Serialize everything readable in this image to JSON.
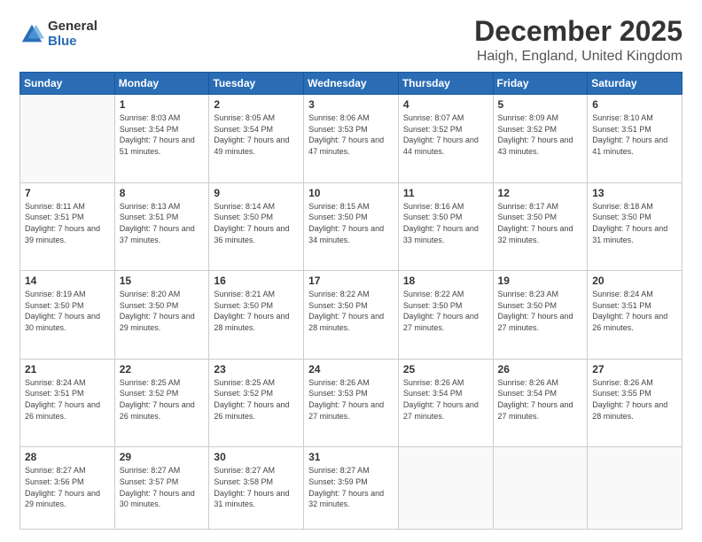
{
  "logo": {
    "general": "General",
    "blue": "Blue"
  },
  "title": "December 2025",
  "subtitle": "Haigh, England, United Kingdom",
  "days": [
    "Sunday",
    "Monday",
    "Tuesday",
    "Wednesday",
    "Thursday",
    "Friday",
    "Saturday"
  ],
  "weeks": [
    [
      {
        "num": "",
        "sunrise": "",
        "sunset": "",
        "daylight": ""
      },
      {
        "num": "1",
        "sunrise": "Sunrise: 8:03 AM",
        "sunset": "Sunset: 3:54 PM",
        "daylight": "Daylight: 7 hours and 51 minutes."
      },
      {
        "num": "2",
        "sunrise": "Sunrise: 8:05 AM",
        "sunset": "Sunset: 3:54 PM",
        "daylight": "Daylight: 7 hours and 49 minutes."
      },
      {
        "num": "3",
        "sunrise": "Sunrise: 8:06 AM",
        "sunset": "Sunset: 3:53 PM",
        "daylight": "Daylight: 7 hours and 47 minutes."
      },
      {
        "num": "4",
        "sunrise": "Sunrise: 8:07 AM",
        "sunset": "Sunset: 3:52 PM",
        "daylight": "Daylight: 7 hours and 44 minutes."
      },
      {
        "num": "5",
        "sunrise": "Sunrise: 8:09 AM",
        "sunset": "Sunset: 3:52 PM",
        "daylight": "Daylight: 7 hours and 43 minutes."
      },
      {
        "num": "6",
        "sunrise": "Sunrise: 8:10 AM",
        "sunset": "Sunset: 3:51 PM",
        "daylight": "Daylight: 7 hours and 41 minutes."
      }
    ],
    [
      {
        "num": "7",
        "sunrise": "Sunrise: 8:11 AM",
        "sunset": "Sunset: 3:51 PM",
        "daylight": "Daylight: 7 hours and 39 minutes."
      },
      {
        "num": "8",
        "sunrise": "Sunrise: 8:13 AM",
        "sunset": "Sunset: 3:51 PM",
        "daylight": "Daylight: 7 hours and 37 minutes."
      },
      {
        "num": "9",
        "sunrise": "Sunrise: 8:14 AM",
        "sunset": "Sunset: 3:50 PM",
        "daylight": "Daylight: 7 hours and 36 minutes."
      },
      {
        "num": "10",
        "sunrise": "Sunrise: 8:15 AM",
        "sunset": "Sunset: 3:50 PM",
        "daylight": "Daylight: 7 hours and 34 minutes."
      },
      {
        "num": "11",
        "sunrise": "Sunrise: 8:16 AM",
        "sunset": "Sunset: 3:50 PM",
        "daylight": "Daylight: 7 hours and 33 minutes."
      },
      {
        "num": "12",
        "sunrise": "Sunrise: 8:17 AM",
        "sunset": "Sunset: 3:50 PM",
        "daylight": "Daylight: 7 hours and 32 minutes."
      },
      {
        "num": "13",
        "sunrise": "Sunrise: 8:18 AM",
        "sunset": "Sunset: 3:50 PM",
        "daylight": "Daylight: 7 hours and 31 minutes."
      }
    ],
    [
      {
        "num": "14",
        "sunrise": "Sunrise: 8:19 AM",
        "sunset": "Sunset: 3:50 PM",
        "daylight": "Daylight: 7 hours and 30 minutes."
      },
      {
        "num": "15",
        "sunrise": "Sunrise: 8:20 AM",
        "sunset": "Sunset: 3:50 PM",
        "daylight": "Daylight: 7 hours and 29 minutes."
      },
      {
        "num": "16",
        "sunrise": "Sunrise: 8:21 AM",
        "sunset": "Sunset: 3:50 PM",
        "daylight": "Daylight: 7 hours and 28 minutes."
      },
      {
        "num": "17",
        "sunrise": "Sunrise: 8:22 AM",
        "sunset": "Sunset: 3:50 PM",
        "daylight": "Daylight: 7 hours and 28 minutes."
      },
      {
        "num": "18",
        "sunrise": "Sunrise: 8:22 AM",
        "sunset": "Sunset: 3:50 PM",
        "daylight": "Daylight: 7 hours and 27 minutes."
      },
      {
        "num": "19",
        "sunrise": "Sunrise: 8:23 AM",
        "sunset": "Sunset: 3:50 PM",
        "daylight": "Daylight: 7 hours and 27 minutes."
      },
      {
        "num": "20",
        "sunrise": "Sunrise: 8:24 AM",
        "sunset": "Sunset: 3:51 PM",
        "daylight": "Daylight: 7 hours and 26 minutes."
      }
    ],
    [
      {
        "num": "21",
        "sunrise": "Sunrise: 8:24 AM",
        "sunset": "Sunset: 3:51 PM",
        "daylight": "Daylight: 7 hours and 26 minutes."
      },
      {
        "num": "22",
        "sunrise": "Sunrise: 8:25 AM",
        "sunset": "Sunset: 3:52 PM",
        "daylight": "Daylight: 7 hours and 26 minutes."
      },
      {
        "num": "23",
        "sunrise": "Sunrise: 8:25 AM",
        "sunset": "Sunset: 3:52 PM",
        "daylight": "Daylight: 7 hours and 26 minutes."
      },
      {
        "num": "24",
        "sunrise": "Sunrise: 8:26 AM",
        "sunset": "Sunset: 3:53 PM",
        "daylight": "Daylight: 7 hours and 27 minutes."
      },
      {
        "num": "25",
        "sunrise": "Sunrise: 8:26 AM",
        "sunset": "Sunset: 3:54 PM",
        "daylight": "Daylight: 7 hours and 27 minutes."
      },
      {
        "num": "26",
        "sunrise": "Sunrise: 8:26 AM",
        "sunset": "Sunset: 3:54 PM",
        "daylight": "Daylight: 7 hours and 27 minutes."
      },
      {
        "num": "27",
        "sunrise": "Sunrise: 8:26 AM",
        "sunset": "Sunset: 3:55 PM",
        "daylight": "Daylight: 7 hours and 28 minutes."
      }
    ],
    [
      {
        "num": "28",
        "sunrise": "Sunrise: 8:27 AM",
        "sunset": "Sunset: 3:56 PM",
        "daylight": "Daylight: 7 hours and 29 minutes."
      },
      {
        "num": "29",
        "sunrise": "Sunrise: 8:27 AM",
        "sunset": "Sunset: 3:57 PM",
        "daylight": "Daylight: 7 hours and 30 minutes."
      },
      {
        "num": "30",
        "sunrise": "Sunrise: 8:27 AM",
        "sunset": "Sunset: 3:58 PM",
        "daylight": "Daylight: 7 hours and 31 minutes."
      },
      {
        "num": "31",
        "sunrise": "Sunrise: 8:27 AM",
        "sunset": "Sunset: 3:59 PM",
        "daylight": "Daylight: 7 hours and 32 minutes."
      },
      {
        "num": "",
        "sunrise": "",
        "sunset": "",
        "daylight": ""
      },
      {
        "num": "",
        "sunrise": "",
        "sunset": "",
        "daylight": ""
      },
      {
        "num": "",
        "sunrise": "",
        "sunset": "",
        "daylight": ""
      }
    ]
  ]
}
